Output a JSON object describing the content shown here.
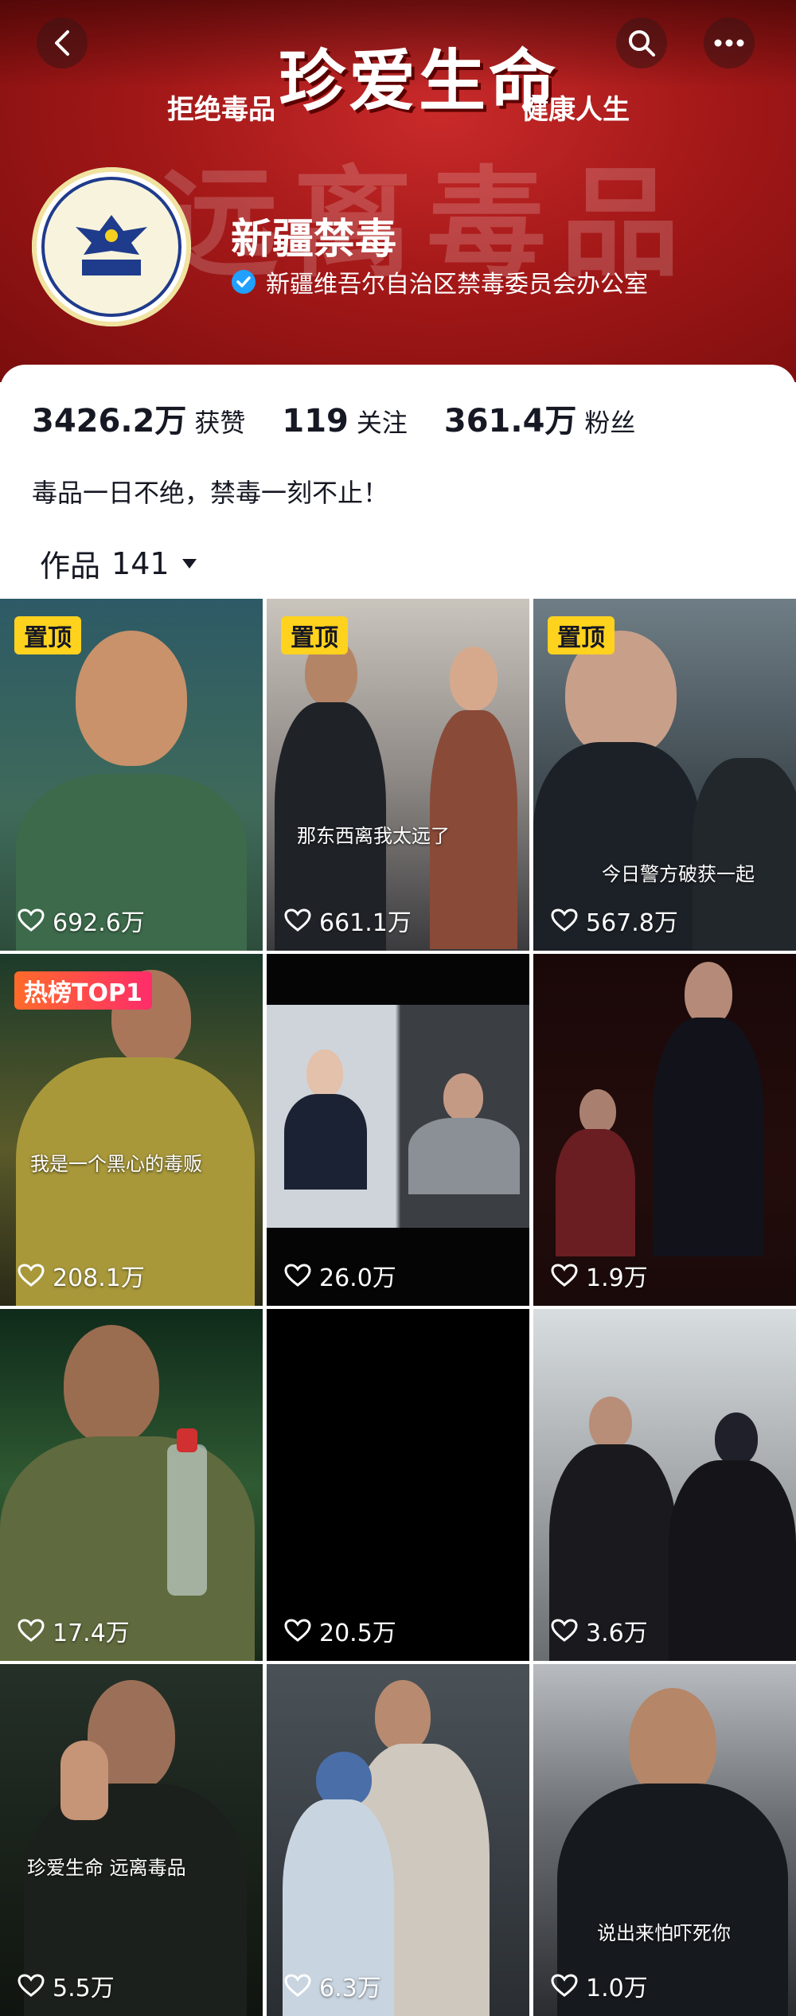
{
  "header": {
    "slogan_left": "拒绝毒品",
    "slogan_center": "珍爱生命",
    "slogan_right": "健康人生",
    "banner_bg_text": "远离毒品",
    "account_name": "新疆禁毒",
    "verified_label": "新疆维吾尔自治区禁毒委员会办公室",
    "accent_color": "#20a0ff"
  },
  "stats": [
    {
      "value": "3426.2万",
      "label": "获赞"
    },
    {
      "value": "119",
      "label": "关注"
    },
    {
      "value": "361.4万",
      "label": "粉丝"
    }
  ],
  "bio": "毒品一日不绝，禁毒一刻不止！",
  "works": {
    "label": "作品",
    "count": "141"
  },
  "videos": [
    {
      "badge": "置顶",
      "likes": "692.6万",
      "caption": ""
    },
    {
      "badge": "置顶",
      "likes": "661.1万",
      "caption": "那东西离我太远了"
    },
    {
      "badge": "置顶",
      "likes": "567.8万",
      "caption": "今日警方破获一起"
    },
    {
      "badge": "热榜TOP1",
      "likes": "208.1万",
      "caption": "我是一个黑心的毒贩"
    },
    {
      "badge": "",
      "likes": "26.0万",
      "caption": ""
    },
    {
      "badge": "",
      "likes": "1.9万",
      "caption": ""
    },
    {
      "badge": "",
      "likes": "17.4万",
      "caption": ""
    },
    {
      "badge": "",
      "likes": "20.5万",
      "caption": ""
    },
    {
      "badge": "",
      "likes": "3.6万",
      "caption": ""
    },
    {
      "badge": "",
      "likes": "5.5万",
      "caption": "珍爱生命 远离毒品"
    },
    {
      "badge": "",
      "likes": "6.3万",
      "caption": ""
    },
    {
      "badge": "",
      "likes": "1.0万",
      "caption": "说出来怕吓死你"
    }
  ]
}
